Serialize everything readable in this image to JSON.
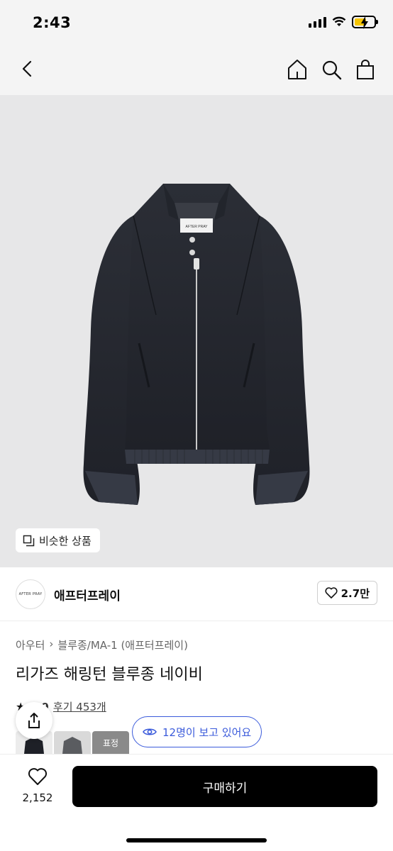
{
  "status": {
    "time": "2:43"
  },
  "hero": {
    "jacket_label": "AFTER PRAY",
    "similar_label": "비슷한 상품"
  },
  "brand": {
    "logo_text": "AFTER PRAY",
    "name": "애프터프레이",
    "likes": "2.7만"
  },
  "breadcrumb": {
    "category": "아우터",
    "sub_category": "블루종/MA-1 (애프터프레이)"
  },
  "product": {
    "title": "리가즈 해링턴 블루종 네이비"
  },
  "reviews": {
    "rating": "4.9",
    "review_label": "후기 453개"
  },
  "thumbnails": [
    {
      "label": ""
    },
    {
      "label": ""
    },
    {
      "label": "표정"
    }
  ],
  "viewers": {
    "label": "12명이 보고 있어요"
  },
  "bottom_bar": {
    "wish_count": "2,152",
    "buy_label": "구매하기"
  },
  "colors": {
    "accent_blue": "#3b5bdb",
    "buy_button": "#000000",
    "jacket": "#262930"
  }
}
